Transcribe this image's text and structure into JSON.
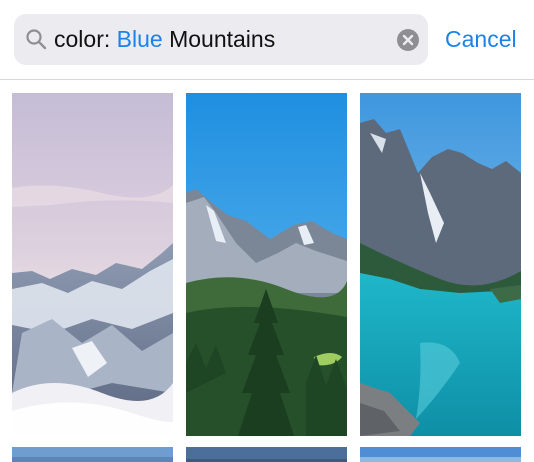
{
  "search": {
    "prefix": "color:",
    "token": "Blue",
    "rest": "Mountains",
    "cancel_label": "Cancel",
    "icon": "search-icon",
    "clear_icon": "clear-icon"
  },
  "results": [
    {
      "subject": "snowy-mountain-clouds"
    },
    {
      "subject": "alpine-pine-forest"
    },
    {
      "subject": "turquoise-mountain-lake"
    }
  ],
  "colors": {
    "accent": "#1a82e8",
    "field_bg": "#ececf0"
  }
}
